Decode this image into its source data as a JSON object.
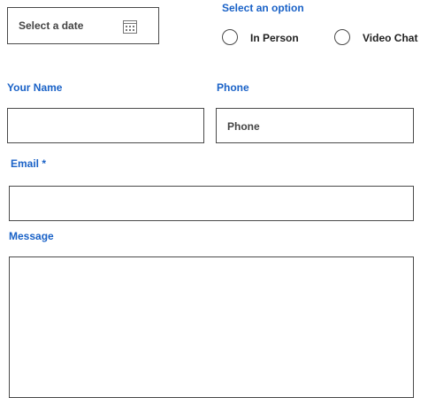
{
  "date_picker": {
    "placeholder": "Select a date",
    "icon": "calendar-icon"
  },
  "meeting_type": {
    "label": "Select an option",
    "options": [
      {
        "label": "In Person",
        "checked": false
      },
      {
        "label": "Video Chat",
        "checked": false
      }
    ]
  },
  "name_field": {
    "label": "Your Name",
    "value": "",
    "placeholder": ""
  },
  "phone_field": {
    "label": "Phone",
    "placeholder": "Phone",
    "value": ""
  },
  "email_field": {
    "label": "Email *",
    "value": "",
    "placeholder": ""
  },
  "message_field": {
    "label": "Message",
    "value": "",
    "placeholder": ""
  },
  "colors": {
    "label_blue": "#1a62c7",
    "border": "#4a4a4a"
  }
}
